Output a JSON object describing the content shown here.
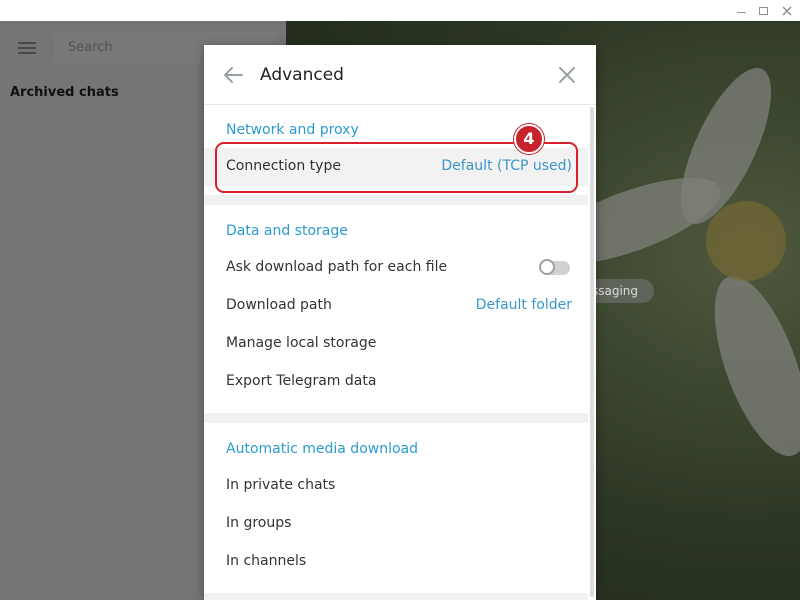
{
  "window": {
    "minimize": "minimize",
    "maximize": "maximize",
    "close": "close"
  },
  "sidebar": {
    "search_placeholder": "Search",
    "archived_label": "Archived chats"
  },
  "chat": {
    "pill_text": "ssaging"
  },
  "dialog": {
    "title": "Advanced",
    "sections": {
      "network": {
        "title": "Network and proxy",
        "connection_label": "Connection type",
        "connection_value": "Default (TCP used)"
      },
      "data": {
        "title": "Data and storage",
        "ask_download_label": "Ask download path for each file",
        "ask_download_enabled": false,
        "download_path_label": "Download path",
        "download_path_value": "Default folder",
        "manage_storage_label": "Manage local storage",
        "export_label": "Export Telegram data"
      },
      "media": {
        "title": "Automatic media download",
        "private_label": "In private chats",
        "groups_label": "In groups",
        "channels_label": "In channels"
      }
    }
  },
  "annotation": {
    "step_number": "4",
    "color": "#d8202c"
  },
  "colors": {
    "accent": "#2b9bd1",
    "link": "#3a96c9"
  }
}
